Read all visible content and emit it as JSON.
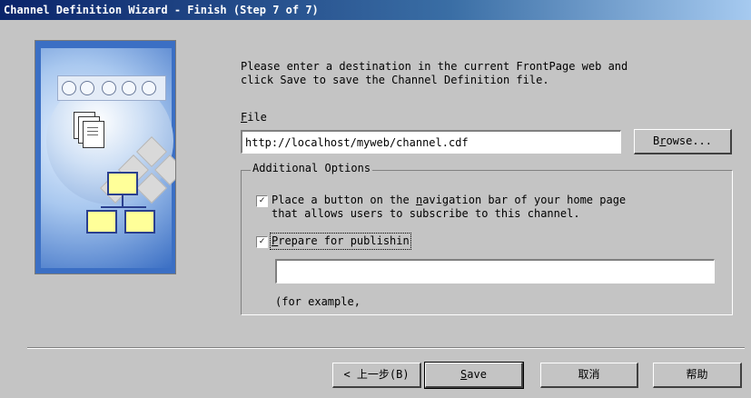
{
  "window": {
    "title": "Channel Definition Wizard - Finish (Step 7 of 7)"
  },
  "instruction": "Please enter a destination in the current FrontPage web and\nclick Save to save the Channel Definition file.",
  "file": {
    "label_underlined": "F",
    "label_rest": "ile",
    "value": "http://localhost/myweb/channel.cdf",
    "browse_underlined": "r",
    "browse_pre": "B",
    "browse_rest": "owse..."
  },
  "additional_options": {
    "title": "Additional Options",
    "navbar_checkbox": {
      "checked": true,
      "label_pre": "Place a button on the ",
      "label_underlined": "n",
      "label_rest": "avigation bar of your home page\nthat allows users to subscribe to this channel."
    },
    "publish_checkbox": {
      "checked": true,
      "label_underlined": "P",
      "label_rest": "repare for publishin"
    },
    "publish_value": "",
    "example_text": "(for example,"
  },
  "footer": {
    "back_label": "< 上一步(B)",
    "save_underlined": "S",
    "save_rest": "ave",
    "cancel_label": "取消",
    "help_label": "帮助"
  }
}
